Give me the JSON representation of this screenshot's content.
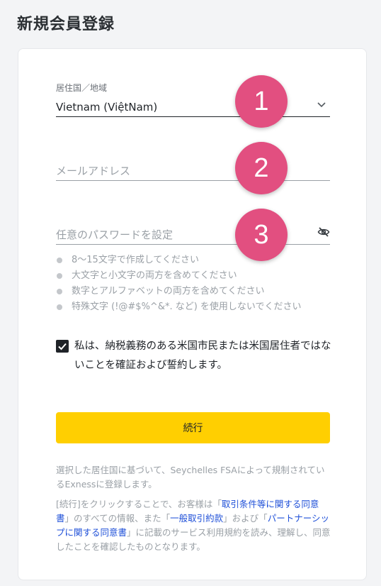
{
  "page": {
    "title": "新規会員登録"
  },
  "country": {
    "label": "居住国／地域",
    "value": "Vietnam (ViệtNam)"
  },
  "email": {
    "placeholder": "メールアドレス"
  },
  "password": {
    "placeholder": "任意のパスワードを設定",
    "rules": [
      "8〜15文字で作成してください",
      "大文字と小文字の両方を含めてください",
      "数字とアルファベットの両方を含めてください",
      "特殊文字 (!@#$%^&*. など) を使用しないでください"
    ]
  },
  "steps": [
    "1",
    "2",
    "3"
  ],
  "consent": {
    "checked": true,
    "text": "私は、納税義務のある米国市民または米国居住者ではないことを確証および誓約します。"
  },
  "continue_label": "続行",
  "notice1": "選択した居住国に基づいて、Seychelles FSAによって規制されているExnessに登録します。",
  "notice2": {
    "t1": "[続行]をクリックすることで、お客様は「",
    "link1": "取引条件等に関する同意書",
    "t2": "」のすべての情報、また「",
    "link2": "一般取引約款",
    "t3": "」および「",
    "link3": "パートナーシップに関する同意書",
    "t4": "」に記載のサービス利用規約を読み、理解し、同意したことを確認したものとなります。"
  },
  "colors": {
    "accent_button": "#ffcf01",
    "badge": "#e24f80",
    "link": "#1e4fd8"
  }
}
